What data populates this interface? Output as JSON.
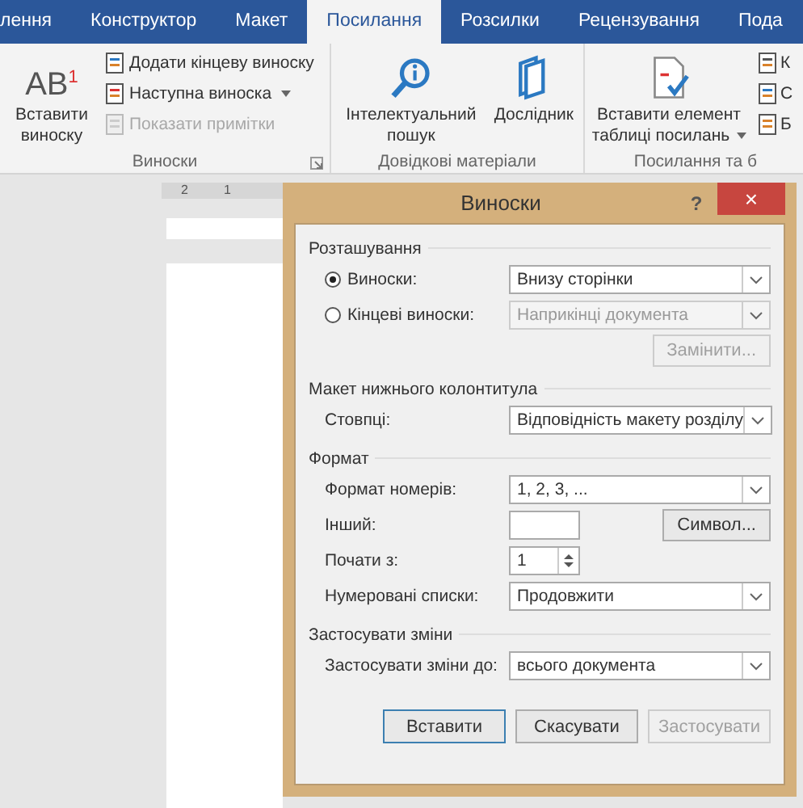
{
  "tabs": [
    {
      "label": "лення",
      "selected": false
    },
    {
      "label": "Конструктор",
      "selected": false
    },
    {
      "label": "Макет",
      "selected": false
    },
    {
      "label": "Посилання",
      "selected": true
    },
    {
      "label": "Розсилки",
      "selected": false
    },
    {
      "label": "Рецензування",
      "selected": false
    },
    {
      "label": "Пода",
      "selected": false
    }
  ],
  "ribbon": {
    "groups": [
      {
        "label": "Виноски",
        "launcher": true,
        "large": [
          {
            "kind": "ab",
            "icon_text": "AB$^{1}$",
            "label": "Вставити виноску"
          }
        ],
        "small": [
          {
            "kind": "endnote",
            "label": "Додати кінцеву виноску",
            "disabled": false
          },
          {
            "kind": "next",
            "label": "Наступна виноска",
            "disabled": false,
            "dropdown": true
          },
          {
            "kind": "show",
            "label": "Показати примітки",
            "disabled": true
          }
        ]
      },
      {
        "label": "Довідкові матеріали",
        "large": [
          {
            "kind": "search",
            "label": "Інтелектуальний пошук"
          },
          {
            "kind": "book",
            "label": "Дослідник"
          }
        ]
      },
      {
        "label": "Посилання та б",
        "large": [
          {
            "kind": "cite",
            "label": "Вставити елемент таблиці посилань",
            "dropdown": true
          }
        ],
        "small": [
          {
            "kind": "manage",
            "label": "К",
            "disabled": false
          },
          {
            "kind": "style",
            "label": "С",
            "disabled": false
          },
          {
            "kind": "biblio",
            "label": "Б",
            "disabled": false
          }
        ]
      }
    ]
  },
  "ruler": {
    "marks": [
      "2",
      "1"
    ]
  },
  "dialog": {
    "title": "Виноски",
    "help": "?",
    "close": "×",
    "sections": [
      {
        "title": "Розташування",
        "rows": [
          {
            "kind": "radio",
            "label": "Виноски:",
            "selected": true,
            "value": "Внизу сторінки",
            "disabled": false
          },
          {
            "kind": "radio",
            "label": "Кінцеві виноски:",
            "selected": false,
            "value": "Наприкінці документа",
            "disabled": true
          },
          {
            "kind": "button",
            "label": "Замінити...",
            "disabled": true
          }
        ]
      },
      {
        "title": "Макет нижнього колонтитула",
        "rows": [
          {
            "kind": "select",
            "label": "Стовпці:",
            "value": "Відповідність макету розділу"
          }
        ]
      },
      {
        "title": "Формат",
        "rows": [
          {
            "kind": "select",
            "label": "Формат номерів:",
            "value": "1, 2, 3, ..."
          },
          {
            "kind": "input",
            "label": "Інший:",
            "button": "Символ..."
          },
          {
            "kind": "spinner",
            "label": "Почати з:",
            "value": "1"
          },
          {
            "kind": "select",
            "label": "Нумеровані списки:",
            "value": "Продовжити"
          }
        ]
      },
      {
        "title": "Застосувати зміни",
        "rows": [
          {
            "kind": "select",
            "label": "Застосувати зміни до:",
            "value": "всього документа"
          }
        ]
      }
    ],
    "buttons": [
      {
        "label": "Вставити",
        "default": true,
        "disabled": false
      },
      {
        "label": "Скасувати",
        "default": false,
        "disabled": false
      },
      {
        "label": "Застосувати",
        "default": false,
        "disabled": true
      }
    ]
  }
}
